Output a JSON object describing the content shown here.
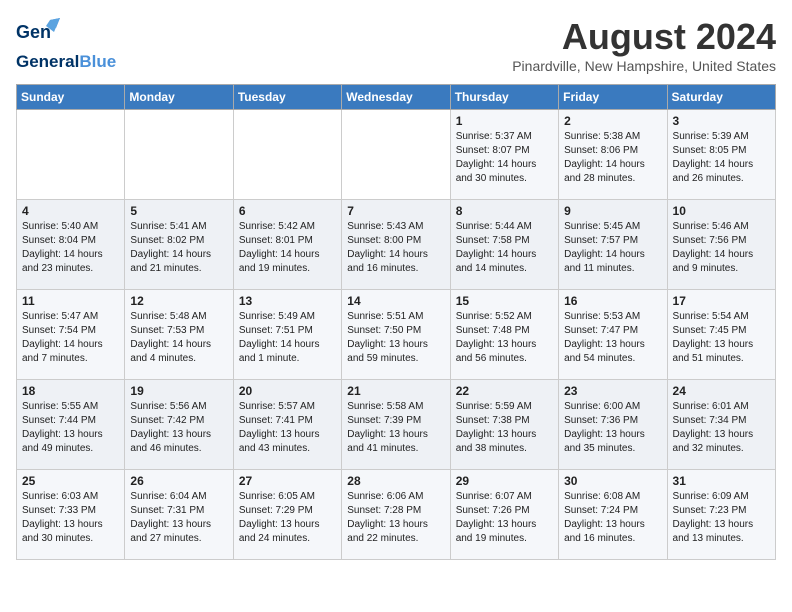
{
  "logo": {
    "general": "General",
    "blue": "Blue"
  },
  "header": {
    "month_year": "August 2024",
    "location": "Pinardville, New Hampshire, United States"
  },
  "weekdays": [
    "Sunday",
    "Monday",
    "Tuesday",
    "Wednesday",
    "Thursday",
    "Friday",
    "Saturday"
  ],
  "weeks": [
    [
      {
        "day": "",
        "info": ""
      },
      {
        "day": "",
        "info": ""
      },
      {
        "day": "",
        "info": ""
      },
      {
        "day": "",
        "info": ""
      },
      {
        "day": "1",
        "info": "Sunrise: 5:37 AM\nSunset: 8:07 PM\nDaylight: 14 hours\nand 30 minutes."
      },
      {
        "day": "2",
        "info": "Sunrise: 5:38 AM\nSunset: 8:06 PM\nDaylight: 14 hours\nand 28 minutes."
      },
      {
        "day": "3",
        "info": "Sunrise: 5:39 AM\nSunset: 8:05 PM\nDaylight: 14 hours\nand 26 minutes."
      }
    ],
    [
      {
        "day": "4",
        "info": "Sunrise: 5:40 AM\nSunset: 8:04 PM\nDaylight: 14 hours\nand 23 minutes."
      },
      {
        "day": "5",
        "info": "Sunrise: 5:41 AM\nSunset: 8:02 PM\nDaylight: 14 hours\nand 21 minutes."
      },
      {
        "day": "6",
        "info": "Sunrise: 5:42 AM\nSunset: 8:01 PM\nDaylight: 14 hours\nand 19 minutes."
      },
      {
        "day": "7",
        "info": "Sunrise: 5:43 AM\nSunset: 8:00 PM\nDaylight: 14 hours\nand 16 minutes."
      },
      {
        "day": "8",
        "info": "Sunrise: 5:44 AM\nSunset: 7:58 PM\nDaylight: 14 hours\nand 14 minutes."
      },
      {
        "day": "9",
        "info": "Sunrise: 5:45 AM\nSunset: 7:57 PM\nDaylight: 14 hours\nand 11 minutes."
      },
      {
        "day": "10",
        "info": "Sunrise: 5:46 AM\nSunset: 7:56 PM\nDaylight: 14 hours\nand 9 minutes."
      }
    ],
    [
      {
        "day": "11",
        "info": "Sunrise: 5:47 AM\nSunset: 7:54 PM\nDaylight: 14 hours\nand 7 minutes."
      },
      {
        "day": "12",
        "info": "Sunrise: 5:48 AM\nSunset: 7:53 PM\nDaylight: 14 hours\nand 4 minutes."
      },
      {
        "day": "13",
        "info": "Sunrise: 5:49 AM\nSunset: 7:51 PM\nDaylight: 14 hours\nand 1 minute."
      },
      {
        "day": "14",
        "info": "Sunrise: 5:51 AM\nSunset: 7:50 PM\nDaylight: 13 hours\nand 59 minutes."
      },
      {
        "day": "15",
        "info": "Sunrise: 5:52 AM\nSunset: 7:48 PM\nDaylight: 13 hours\nand 56 minutes."
      },
      {
        "day": "16",
        "info": "Sunrise: 5:53 AM\nSunset: 7:47 PM\nDaylight: 13 hours\nand 54 minutes."
      },
      {
        "day": "17",
        "info": "Sunrise: 5:54 AM\nSunset: 7:45 PM\nDaylight: 13 hours\nand 51 minutes."
      }
    ],
    [
      {
        "day": "18",
        "info": "Sunrise: 5:55 AM\nSunset: 7:44 PM\nDaylight: 13 hours\nand 49 minutes."
      },
      {
        "day": "19",
        "info": "Sunrise: 5:56 AM\nSunset: 7:42 PM\nDaylight: 13 hours\nand 46 minutes."
      },
      {
        "day": "20",
        "info": "Sunrise: 5:57 AM\nSunset: 7:41 PM\nDaylight: 13 hours\nand 43 minutes."
      },
      {
        "day": "21",
        "info": "Sunrise: 5:58 AM\nSunset: 7:39 PM\nDaylight: 13 hours\nand 41 minutes."
      },
      {
        "day": "22",
        "info": "Sunrise: 5:59 AM\nSunset: 7:38 PM\nDaylight: 13 hours\nand 38 minutes."
      },
      {
        "day": "23",
        "info": "Sunrise: 6:00 AM\nSunset: 7:36 PM\nDaylight: 13 hours\nand 35 minutes."
      },
      {
        "day": "24",
        "info": "Sunrise: 6:01 AM\nSunset: 7:34 PM\nDaylight: 13 hours\nand 32 minutes."
      }
    ],
    [
      {
        "day": "25",
        "info": "Sunrise: 6:03 AM\nSunset: 7:33 PM\nDaylight: 13 hours\nand 30 minutes."
      },
      {
        "day": "26",
        "info": "Sunrise: 6:04 AM\nSunset: 7:31 PM\nDaylight: 13 hours\nand 27 minutes."
      },
      {
        "day": "27",
        "info": "Sunrise: 6:05 AM\nSunset: 7:29 PM\nDaylight: 13 hours\nand 24 minutes."
      },
      {
        "day": "28",
        "info": "Sunrise: 6:06 AM\nSunset: 7:28 PM\nDaylight: 13 hours\nand 22 minutes."
      },
      {
        "day": "29",
        "info": "Sunrise: 6:07 AM\nSunset: 7:26 PM\nDaylight: 13 hours\nand 19 minutes."
      },
      {
        "day": "30",
        "info": "Sunrise: 6:08 AM\nSunset: 7:24 PM\nDaylight: 13 hours\nand 16 minutes."
      },
      {
        "day": "31",
        "info": "Sunrise: 6:09 AM\nSunset: 7:23 PM\nDaylight: 13 hours\nand 13 minutes."
      }
    ]
  ]
}
